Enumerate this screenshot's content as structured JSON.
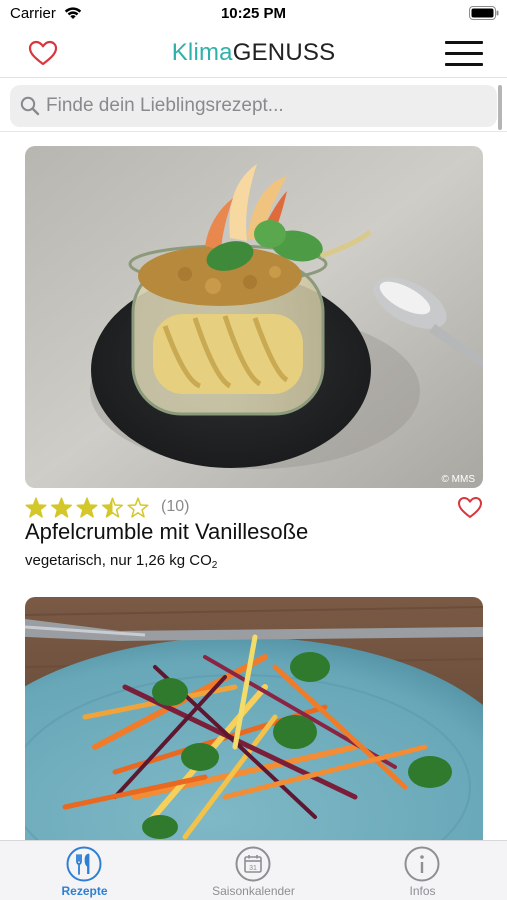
{
  "status_bar": {
    "carrier": "Carrier",
    "time": "10:25 PM"
  },
  "header": {
    "logo_part1": "Klima",
    "logo_part2": "GENUSS",
    "favorites_icon": "heart-outline-icon",
    "menu_icon": "hamburger-menu-icon"
  },
  "search": {
    "placeholder": "Finde dein Lieblingsrezept..."
  },
  "recipes": [
    {
      "title": "Apfelcrumble mit Vanillesoße",
      "rating": 3.5,
      "rating_max": 5,
      "rating_count": "(10)",
      "subtitle_prefix": "vegetarisch, nur 1,26 kg CO",
      "subtitle_sub": "2",
      "image_credit": "© MMS"
    },
    {
      "title": "",
      "image_credit": ""
    }
  ],
  "tabs": [
    {
      "label": "Rezepte",
      "icon": "cutlery-icon",
      "active": true
    },
    {
      "label": "Saisonkalender",
      "icon": "calendar-icon",
      "active": false
    },
    {
      "label": "Infos",
      "icon": "info-icon",
      "active": false
    }
  ],
  "colors": {
    "accent": "#2fb1aa",
    "heart": "#d9363e",
    "tab_active": "#2d7fd2",
    "star": "#d4c72a"
  }
}
